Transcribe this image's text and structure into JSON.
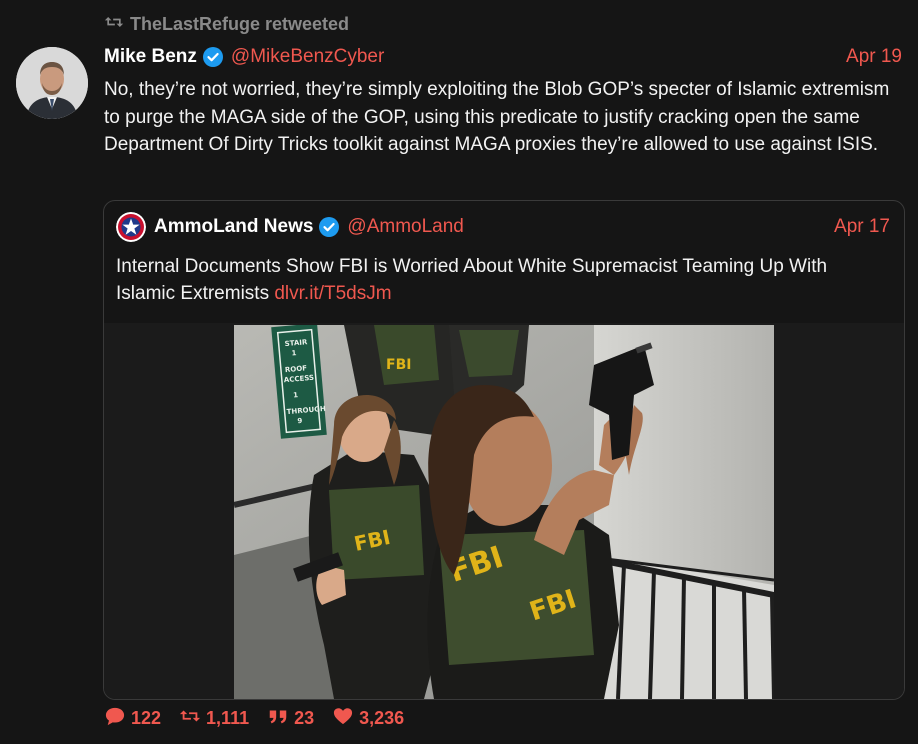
{
  "retweet": {
    "label": "TheLastRefuge retweeted",
    "icon": "retweet-icon"
  },
  "tweet": {
    "author_name": "Mike Benz",
    "author_handle": "@MikeBenzCyber",
    "date": "Apr 19",
    "text": "No, they’re not worried, they’re simply exploiting the Blob GOP’s specter of Islamic extremism to purge the MAGA side of the GOP, using this predicate to justify cracking open the same Department Of Dirty Tricks toolkit against MAGA proxies they’re allowed to use against ISIS."
  },
  "quote": {
    "author_name": "AmmoLand News",
    "author_handle": "@AmmoLand",
    "date": "Apr 17",
    "text": "Internal Documents Show FBI is Worried About White Supremacist Teaming Up With Islamic Extremists",
    "link": "dlvr.it/T5dsJm",
    "image_labels": {
      "sign": "STAIR 1 ROOF ACCESS 1 THROUGH 9",
      "vest": "FBI"
    }
  },
  "stats": {
    "replies": "122",
    "retweets": "1,111",
    "quotes": "23",
    "likes": "3,236"
  },
  "colors": {
    "accent": "#f0584f",
    "verified": "#1d9bf0",
    "background": "#151515"
  }
}
